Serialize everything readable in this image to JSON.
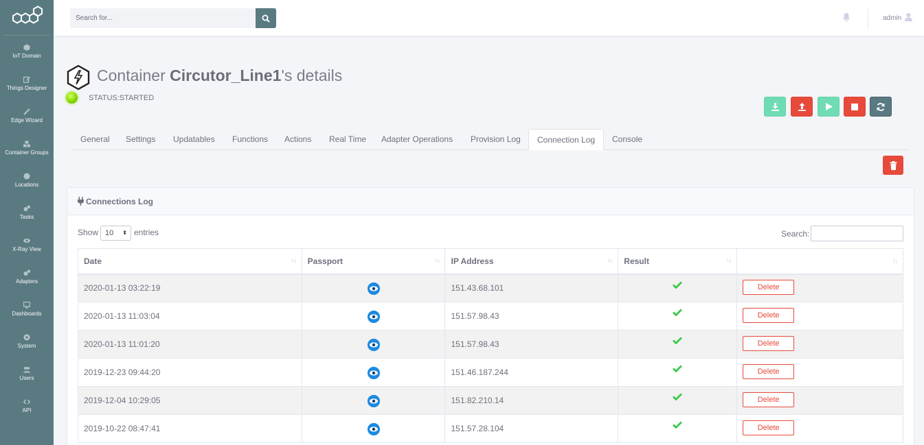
{
  "sidebar": {
    "items": [
      {
        "label": "IoT Domain",
        "icon": "cube-icon"
      },
      {
        "label": "Things Designer",
        "icon": "edit-icon"
      },
      {
        "label": "Edge Wizard",
        "icon": "magic-wand-icon"
      },
      {
        "label": "Container Groups",
        "icon": "cubes-icon"
      },
      {
        "label": "Locations",
        "icon": "globe-icon"
      },
      {
        "label": "Tasks",
        "icon": "cogs-icon"
      },
      {
        "label": "X-Ray View",
        "icon": "eye-icon"
      },
      {
        "label": "Adapters",
        "icon": "cogs-icon"
      },
      {
        "label": "Dashboards",
        "icon": "desktop-icon"
      },
      {
        "label": "System",
        "icon": "gear-icon"
      },
      {
        "label": "Users",
        "icon": "users-icon"
      },
      {
        "label": "API",
        "icon": "code-icon"
      }
    ]
  },
  "topbar": {
    "search_placeholder": "Search for...",
    "user_name": "admin"
  },
  "header": {
    "title_prefix": "Container ",
    "title_name": "Circutor_Line1",
    "title_suffix": "'s details",
    "status": "STATUS:STARTED"
  },
  "actions": {
    "colors": {
      "download": "#6fdcb4",
      "upload": "#e74a3b",
      "play": "#6fdcb4",
      "stop": "#e74a3b",
      "refresh": "#5a7a82"
    }
  },
  "tabs": [
    {
      "label": "General"
    },
    {
      "label": "Settings"
    },
    {
      "label": "Updatables"
    },
    {
      "label": "Functions"
    },
    {
      "label": "Actions"
    },
    {
      "label": "Real Time"
    },
    {
      "label": "Adapter Operations"
    },
    {
      "label": "Provision Log"
    },
    {
      "label": "Connection Log",
      "active": true
    },
    {
      "label": "Console"
    }
  ],
  "card": {
    "title": "Connections Log",
    "show_label": "Show",
    "show_value": "10",
    "entries_label": "entries",
    "search_label": "Search:"
  },
  "table": {
    "columns": [
      "Date",
      "Passport",
      "IP Address",
      "Result",
      ""
    ],
    "delete_label": "Delete",
    "rows": [
      {
        "date": "2020-01-13 03:22:19",
        "ip": "151.43.68.101"
      },
      {
        "date": "2020-01-13 11:03:04",
        "ip": "151.57.98.43"
      },
      {
        "date": "2020-01-13 11:01:20",
        "ip": "151.57.98.43"
      },
      {
        "date": "2019-12-23 09:44:20",
        "ip": "151.46.187.244"
      },
      {
        "date": "2019-12-04 10:29:05",
        "ip": "151.82.210.14"
      },
      {
        "date": "2019-10-22 08:47:41",
        "ip": "151.57.28.104"
      }
    ]
  }
}
